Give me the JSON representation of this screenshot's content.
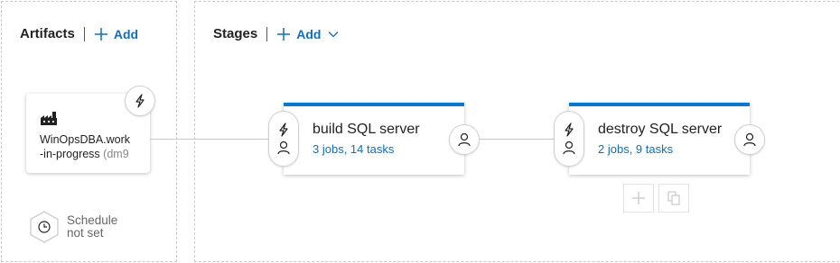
{
  "artifacts": {
    "title": "Artifacts",
    "add_label": "Add",
    "card": {
      "name_line1": "WinOpsDBA.work",
      "name_line2": "-in-progress",
      "name_suffix": "(dm9"
    },
    "schedule": {
      "line1": "Schedule",
      "line2": "not set"
    }
  },
  "stages": {
    "title": "Stages",
    "add_label": "Add",
    "items": [
      {
        "name": "build SQL server",
        "jobs": "3 jobs, 14 tasks"
      },
      {
        "name": "destroy SQL server",
        "jobs": "2 jobs, 9 tasks"
      }
    ]
  },
  "colors": {
    "accent": "#0078d4",
    "link": "#106ebe"
  },
  "icons": {
    "artifact": "build-icon",
    "trigger": "lightning-icon",
    "approver": "person-icon",
    "schedule": "clock-icon",
    "add": "plus-icon",
    "clone": "copy-icon",
    "dropdown": "chevron-down-icon"
  }
}
